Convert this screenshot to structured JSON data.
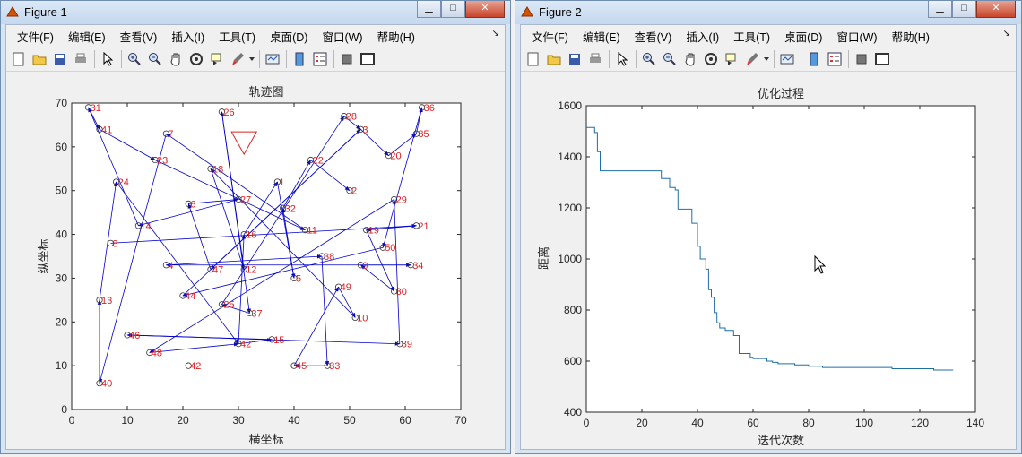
{
  "figure1": {
    "title": "Figure 1",
    "menu": [
      "文件(F)",
      "编辑(E)",
      "查看(V)",
      "插入(I)",
      "工具(T)",
      "桌面(D)",
      "窗口(W)",
      "帮助(H)"
    ],
    "plot": {
      "title": "轨迹图",
      "xlabel": "横坐标",
      "ylabel": "纵坐标",
      "xticks": [
        "0",
        "10",
        "20",
        "30",
        "40",
        "50",
        "60",
        "70"
      ],
      "yticks": [
        "0",
        "10",
        "20",
        "30",
        "40",
        "50",
        "60",
        "70"
      ]
    }
  },
  "figure2": {
    "title": "Figure 2",
    "menu": [
      "文件(F)",
      "编辑(E)",
      "查看(V)",
      "插入(I)",
      "工具(T)",
      "桌面(D)",
      "窗口(W)",
      "帮助(H)"
    ],
    "plot": {
      "title": "优化过程",
      "xlabel": "迭代次数",
      "ylabel": "距离",
      "xticks": [
        "0",
        "20",
        "40",
        "60",
        "80",
        "100",
        "120",
        "140"
      ],
      "yticks": [
        "400",
        "600",
        "800",
        "1000",
        "1200",
        "1400",
        "1600"
      ]
    }
  },
  "colors": {
    "route": "#0000cc",
    "label": "#dd2222",
    "convergence": "#1f6fa5",
    "start_marker": "#dd2222"
  },
  "chart_data": [
    {
      "type": "scatter",
      "title": "轨迹图",
      "xlabel": "横坐标",
      "ylabel": "纵坐标",
      "xlim": [
        0,
        70
      ],
      "ylim": [
        0,
        70
      ],
      "grid": false,
      "start_point": [
        31,
        62
      ],
      "points": [
        {
          "label": "31",
          "x": 3,
          "y": 69
        },
        {
          "label": "26",
          "x": 27,
          "y": 68
        },
        {
          "label": "28",
          "x": 49,
          "y": 67
        },
        {
          "label": "36",
          "x": 63,
          "y": 69
        },
        {
          "label": "41",
          "x": 5,
          "y": 64
        },
        {
          "label": "3",
          "x": 52,
          "y": 64
        },
        {
          "label": "35",
          "x": 62,
          "y": 63
        },
        {
          "label": "7",
          "x": 17,
          "y": 63
        },
        {
          "label": "23",
          "x": 15,
          "y": 57
        },
        {
          "label": "20",
          "x": 57,
          "y": 58
        },
        {
          "label": "22",
          "x": 43,
          "y": 57
        },
        {
          "label": "18",
          "x": 25,
          "y": 55
        },
        {
          "label": "24",
          "x": 8,
          "y": 52
        },
        {
          "label": "1",
          "x": 37,
          "y": 52
        },
        {
          "label": "2",
          "x": 50,
          "y": 50
        },
        {
          "label": "29",
          "x": 58,
          "y": 48
        },
        {
          "label": "27",
          "x": 30,
          "y": 48
        },
        {
          "label": "6",
          "x": 21,
          "y": 47
        },
        {
          "label": "32",
          "x": 38,
          "y": 46
        },
        {
          "label": "14",
          "x": 12,
          "y": 42
        },
        {
          "label": "21",
          "x": 62,
          "y": 42
        },
        {
          "label": "11",
          "x": 42,
          "y": 41
        },
        {
          "label": "19",
          "x": 53,
          "y": 41
        },
        {
          "label": "16",
          "x": 31,
          "y": 40
        },
        {
          "label": "8",
          "x": 7,
          "y": 38
        },
        {
          "label": "50",
          "x": 56,
          "y": 37
        },
        {
          "label": "38",
          "x": 45,
          "y": 35
        },
        {
          "label": "34",
          "x": 61,
          "y": 33
        },
        {
          "label": "4",
          "x": 17,
          "y": 33
        },
        {
          "label": "47",
          "x": 25,
          "y": 32
        },
        {
          "label": "12",
          "x": 31,
          "y": 32
        },
        {
          "label": "9",
          "x": 52,
          "y": 33
        },
        {
          "label": "5",
          "x": 40,
          "y": 30
        },
        {
          "label": "30",
          "x": 58,
          "y": 27
        },
        {
          "label": "49",
          "x": 48,
          "y": 28
        },
        {
          "label": "44",
          "x": 20,
          "y": 26
        },
        {
          "label": "13",
          "x": 5,
          "y": 25
        },
        {
          "label": "25",
          "x": 27,
          "y": 24
        },
        {
          "label": "37",
          "x": 32,
          "y": 22
        },
        {
          "label": "10",
          "x": 51,
          "y": 21
        },
        {
          "label": "46",
          "x": 10,
          "y": 17
        },
        {
          "label": "15",
          "x": 36,
          "y": 16
        },
        {
          "label": "39",
          "x": 59,
          "y": 15
        },
        {
          "label": "42",
          "x": 30,
          "y": 15
        },
        {
          "label": "48",
          "x": 14,
          "y": 13
        },
        {
          "label": "42",
          "x": 21,
          "y": 10
        },
        {
          "label": "45",
          "x": 40,
          "y": 10
        },
        {
          "label": "33",
          "x": 46,
          "y": 10
        },
        {
          "label": "40",
          "x": 5,
          "y": 6
        }
      ],
      "route": [
        "16",
        "1",
        "5",
        "32",
        "22",
        "2",
        "17",
        "8",
        "21",
        "19",
        "30",
        "9",
        "34",
        "4",
        "38",
        "33",
        "45",
        "49",
        "10",
        "18",
        "12",
        "26",
        "37",
        "25",
        "28",
        "3",
        "20",
        "35",
        "36",
        "50",
        "44",
        "3",
        "47",
        "6",
        "27",
        "14",
        "31",
        "41",
        "23",
        "11",
        "7",
        "40",
        "13",
        "24",
        "42",
        "15",
        "46",
        "39",
        "29",
        "48",
        "42",
        "16"
      ]
    },
    {
      "type": "line",
      "title": "优化过程",
      "xlabel": "迭代次数",
      "ylabel": "距离",
      "xlim": [
        0,
        140
      ],
      "ylim": [
        400,
        1600
      ],
      "grid": false,
      "series": [
        {
          "x": [
            0,
            2,
            3,
            4,
            5,
            9,
            26,
            27,
            29,
            30,
            32,
            33,
            37,
            38,
            40,
            41,
            43,
            44,
            45,
            46,
            47,
            48,
            50,
            51,
            53,
            55,
            57,
            59,
            60,
            62,
            65,
            67,
            69,
            72,
            75,
            80,
            83,
            85,
            88,
            110,
            113,
            125,
            132
          ],
          "y": [
            1515,
            1515,
            1495,
            1420,
            1345,
            1345,
            1345,
            1315,
            1315,
            1280,
            1270,
            1195,
            1195,
            1140,
            1050,
            1000,
            960,
            880,
            850,
            790,
            750,
            730,
            720,
            720,
            700,
            630,
            630,
            615,
            610,
            610,
            600,
            595,
            590,
            590,
            585,
            580,
            580,
            575,
            575,
            570,
            570,
            565,
            565
          ]
        }
      ]
    }
  ]
}
